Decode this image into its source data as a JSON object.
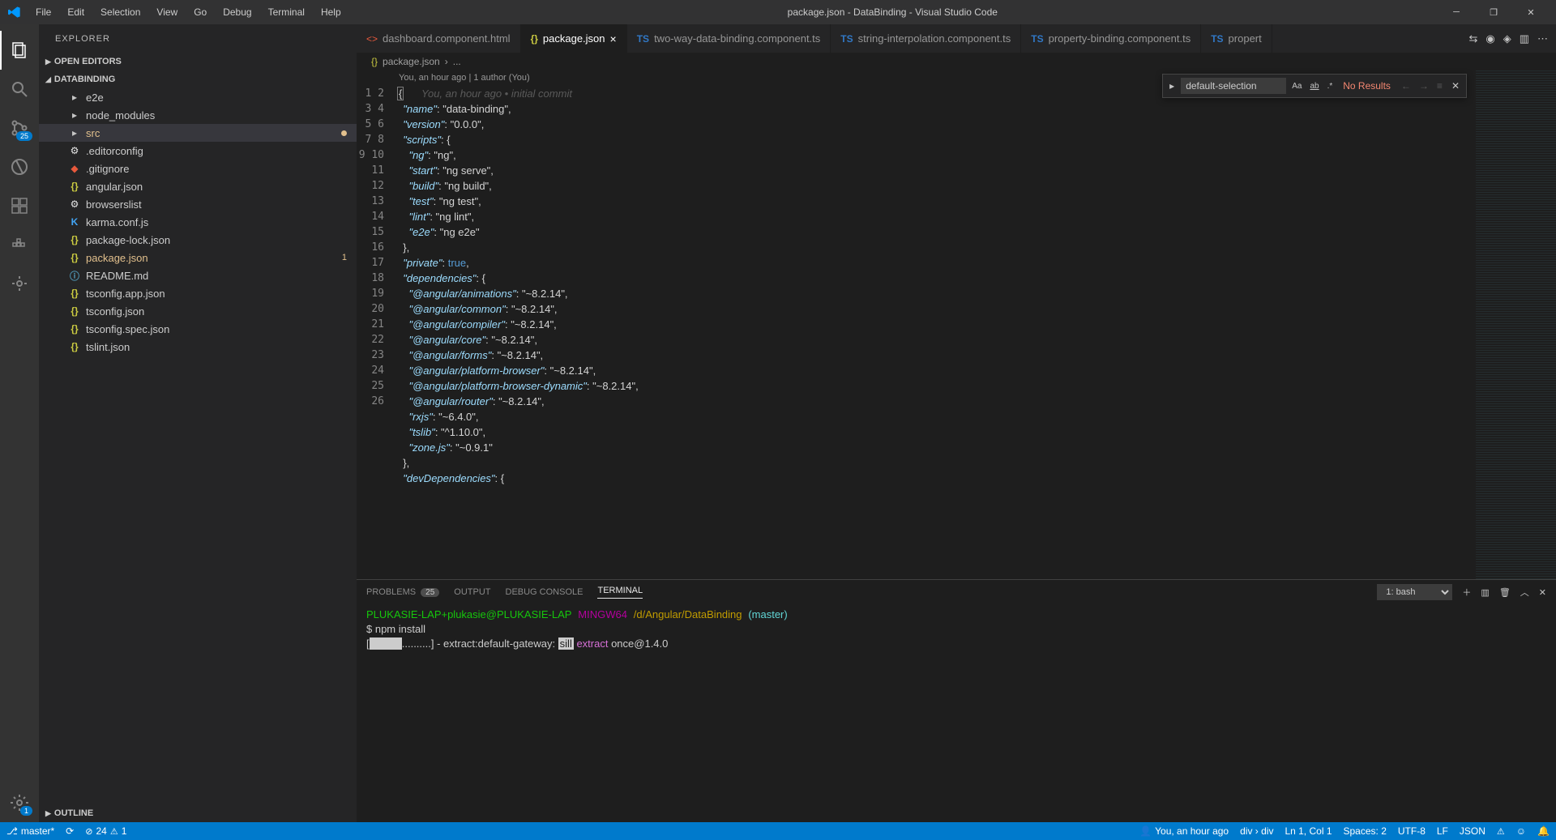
{
  "window": {
    "title": "package.json - DataBinding - Visual Studio Code"
  },
  "menu": [
    "File",
    "Edit",
    "Selection",
    "View",
    "Go",
    "Debug",
    "Terminal",
    "Help"
  ],
  "activitybar": {
    "scm_badge": "25",
    "settings_badge": "1"
  },
  "sidebar": {
    "title": "EXPLORER",
    "sections": {
      "open_editors": "OPEN EDITORS",
      "project": "DATABINDING",
      "outline": "OUTLINE"
    },
    "tree": [
      {
        "kind": "folder",
        "label": "e2e"
      },
      {
        "kind": "folder",
        "label": "node_modules"
      },
      {
        "kind": "folder",
        "label": "src",
        "modified": true,
        "selected": true
      },
      {
        "kind": "file",
        "icon": "editorcfg",
        "label": ".editorconfig"
      },
      {
        "kind": "file",
        "icon": "git",
        "label": ".gitignore"
      },
      {
        "kind": "file",
        "icon": "json",
        "label": "angular.json"
      },
      {
        "kind": "file",
        "icon": "editorcfg",
        "label": "browserslist"
      },
      {
        "kind": "file",
        "icon": "karma",
        "label": "karma.conf.js"
      },
      {
        "kind": "file",
        "icon": "json",
        "label": "package-lock.json"
      },
      {
        "kind": "file",
        "icon": "json",
        "label": "package.json",
        "modified": true,
        "trail": "1"
      },
      {
        "kind": "file",
        "icon": "readme",
        "label": "README.md"
      },
      {
        "kind": "file",
        "icon": "json",
        "label": "tsconfig.app.json"
      },
      {
        "kind": "file",
        "icon": "json",
        "label": "tsconfig.json"
      },
      {
        "kind": "file",
        "icon": "json",
        "label": "tsconfig.spec.json"
      },
      {
        "kind": "file",
        "icon": "json",
        "label": "tslint.json"
      }
    ]
  },
  "tabs": [
    {
      "icon": "html",
      "label": "dashboard.component.html"
    },
    {
      "icon": "json",
      "label": "package.json",
      "active": true,
      "dirty": false
    },
    {
      "icon": "ts",
      "label": "two-way-data-binding.component.ts"
    },
    {
      "icon": "ts",
      "label": "string-interpolation.component.ts"
    },
    {
      "icon": "ts",
      "label": "property-binding.component.ts"
    },
    {
      "icon": "ts",
      "label": "propert"
    }
  ],
  "breadcrumb": {
    "file": "package.json",
    "rest": "..."
  },
  "codelens": "You, an hour ago | 1 author (You)",
  "blame": "You, an hour ago • initial commit",
  "code_lines": [
    "{",
    "  \"name\": \"data-binding\",",
    "  \"version\": \"0.0.0\",",
    "  \"scripts\": {",
    "    \"ng\": \"ng\",",
    "    \"start\": \"ng serve\",",
    "    \"build\": \"ng build\",",
    "    \"test\": \"ng test\",",
    "    \"lint\": \"ng lint\",",
    "    \"e2e\": \"ng e2e\"",
    "  },",
    "  \"private\": true,",
    "  \"dependencies\": {",
    "    \"@angular/animations\": \"~8.2.14\",",
    "    \"@angular/common\": \"~8.2.14\",",
    "    \"@angular/compiler\": \"~8.2.14\",",
    "    \"@angular/core\": \"~8.2.14\",",
    "    \"@angular/forms\": \"~8.2.14\",",
    "    \"@angular/platform-browser\": \"~8.2.14\",",
    "    \"@angular/platform-browser-dynamic\": \"~8.2.14\",",
    "    \"@angular/router\": \"~8.2.14\",",
    "    \"rxjs\": \"~6.4.0\",",
    "    \"tslib\": \"^1.10.0\",",
    "    \"zone.js\": \"~0.9.1\"",
    "  },",
    "  \"devDependencies\": {"
  ],
  "find": {
    "value": "default-selection",
    "results": "No Results"
  },
  "panel": {
    "tabs": {
      "problems": "PROBLEMS",
      "problems_badge": "25",
      "output": "OUTPUT",
      "debug": "DEBUG CONSOLE",
      "terminal": "TERMINAL"
    },
    "shell_selected": "1: bash",
    "terminal": {
      "prompt_user": "PLUKASIE-LAP+plukasie@PLUKASIE-LAP",
      "prompt_sys": "MINGW64",
      "prompt_path": "/d/Angular/DataBinding",
      "prompt_branch": "(master)",
      "cmd": "$ npm install",
      "progress_pre": "[",
      "progress_bar": "          ",
      "progress_dots": "..........] - extract:default-gateway: ",
      "progress_sill": "sill",
      "progress_extract": " extract",
      "progress_pkg": " once@1.4.0"
    }
  },
  "statusbar": {
    "branch": "master*",
    "errors": "24",
    "warnings": "1",
    "blame": "You, an hour ago",
    "selector": "div › div",
    "pos": "Ln 1, Col 1",
    "spaces": "Spaces: 2",
    "encoding": "UTF-8",
    "eol": "LF",
    "lang": "JSON"
  }
}
